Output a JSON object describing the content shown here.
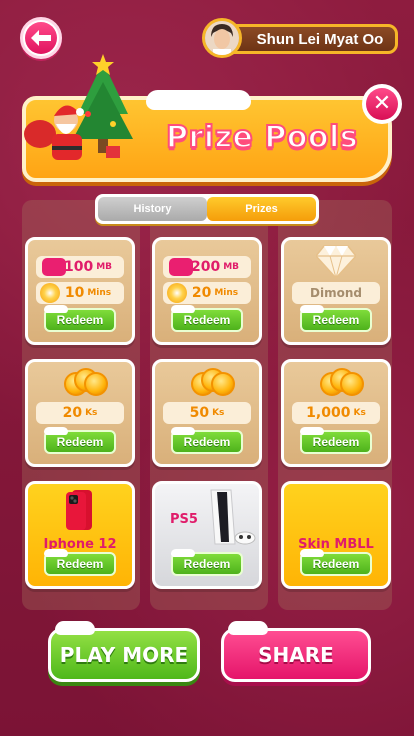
{
  "user": {
    "name": "Shun Lei Myat Oo"
  },
  "header": {
    "title": "Prize Pools"
  },
  "tabs": [
    {
      "label": "History",
      "active": false
    },
    {
      "label": "Prizes",
      "active": true
    }
  ],
  "prizes": {
    "row1": [
      {
        "top_value": "100",
        "top_unit": "MB",
        "bottom_value": "10",
        "bottom_unit": "Mins",
        "redeem": "Redeem"
      },
      {
        "top_value": "200",
        "top_unit": "MB",
        "bottom_value": "20",
        "bottom_unit": "Mins",
        "redeem": "Redeem"
      },
      {
        "label": "Dimond",
        "redeem": "Redeem"
      }
    ],
    "row2": [
      {
        "value": "20",
        "unit": "Ks",
        "redeem": "Redeem"
      },
      {
        "value": "50",
        "unit": "Ks",
        "redeem": "Redeem"
      },
      {
        "value": "1,000",
        "unit": "Ks",
        "redeem": "Redeem"
      }
    ],
    "row3": [
      {
        "label": "Iphone 12",
        "redeem": "Redeem"
      },
      {
        "label": "PS5",
        "redeem": "Redeem"
      },
      {
        "label": "Skin MBLL",
        "redeem": "Redeem"
      }
    ]
  },
  "buttons": {
    "play_more": "PLAY MORE",
    "share": "SHARE"
  },
  "colors": {
    "pink": "#e01c6a",
    "gold": "#ffb405",
    "green": "#4eb21c",
    "background": "#8a1f3e"
  }
}
